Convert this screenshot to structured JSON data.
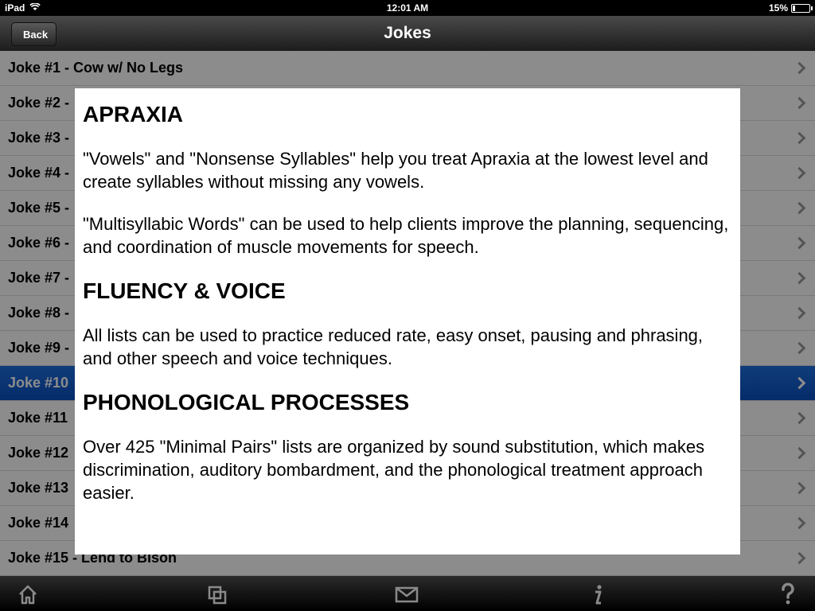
{
  "status_bar": {
    "device": "iPad",
    "time": "12:01 AM",
    "battery_percent": "15%"
  },
  "nav_bar": {
    "back_label": "Back",
    "title": "Jokes"
  },
  "jokes": [
    "Joke #1 - Cow w/ No Legs",
    "Joke #2 -",
    "Joke #3 -",
    "Joke #4 -",
    "Joke #5 -",
    "Joke #6 -",
    "Joke #7 -",
    "Joke #8 -",
    "Joke #9 -",
    "Joke #10",
    "Joke #11",
    "Joke #12",
    "Joke #13",
    "Joke #14",
    "Joke #15 - Lend to Bison"
  ],
  "selected_index": 9,
  "popup": {
    "heading_1": "APRAXIA",
    "para_1": "\"Vowels\" and \"Nonsense Syllables\" help you treat Apraxia at the lowest level and create syllables without missing any vowels.",
    "para_2": "\"Multisyllabic Words\" can be used to help clients improve the planning, sequencing, and coordination of muscle movements for speech.",
    "heading_2": "FLUENCY & VOICE",
    "para_3": "All lists can be used to practice reduced rate, easy onset, pausing and phrasing, and other speech and voice techniques.",
    "heading_3": "PHONOLOGICAL PROCESSES",
    "para_4": "Over 425 \"Minimal Pairs\" lists are organized by sound substitution, which makes discrimination, auditory bombardment, and the phonological treatment approach easier."
  },
  "tab_bar": {
    "icons": [
      "home-icon",
      "copy-icon",
      "mail-icon",
      "info-icon",
      "help-icon"
    ]
  },
  "colors": {
    "selection": "#0a4fc0",
    "nav": "#1c1c1c"
  }
}
